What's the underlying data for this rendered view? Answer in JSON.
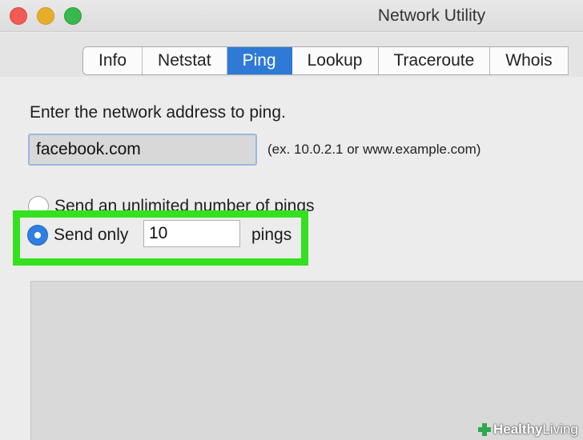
{
  "window": {
    "title": "Network Utility"
  },
  "tabs": [
    {
      "label": "Info",
      "active": false
    },
    {
      "label": "Netstat",
      "active": false
    },
    {
      "label": "Ping",
      "active": true
    },
    {
      "label": "Lookup",
      "active": false
    },
    {
      "label": "Traceroute",
      "active": false
    },
    {
      "label": "Whois",
      "active": false
    }
  ],
  "ping": {
    "prompt": "Enter the network address to ping.",
    "address_value": "facebook.com",
    "address_hint": "(ex. 10.0.2.1 or www.example.com)",
    "option_unlimited_label": "Send an unlimited number of pings",
    "option_send_only_label": "Send only",
    "send_only_selected": true,
    "count_value": "10",
    "count_suffix": "pings"
  },
  "output": {
    "text": ""
  },
  "watermark": {
    "text_bold": "Healthy",
    "text_light": "Living",
    "icon": "plus-icon"
  },
  "colors": {
    "tab_active": "#2e7ad6",
    "highlight_box": "#33e11f",
    "radio_selected": "#2f7ee0",
    "traffic_red": "#f25b55",
    "traffic_yellow": "#e6ad2a",
    "traffic_green": "#39b84c"
  }
}
